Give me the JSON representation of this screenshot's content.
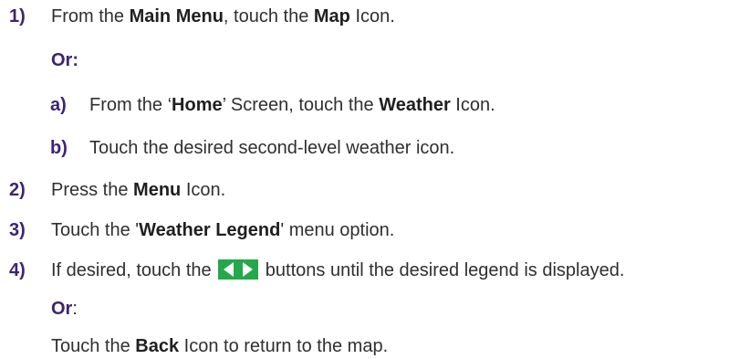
{
  "steps": {
    "s1": {
      "num": "1)",
      "pre": "From the ",
      "b1": "Main Menu",
      "mid": ", touch the ",
      "b2": "Map",
      "post": " Icon."
    },
    "or1": "Or:",
    "sub_a": {
      "num": "a)",
      "pre": "From the ‘",
      "b1": "Home",
      "mid": "’ Screen, touch the ",
      "b2": "Weather",
      "post": " Icon."
    },
    "sub_b": {
      "num": "b)",
      "text": "Touch the desired second-level weather icon."
    },
    "s2": {
      "num": "2)",
      "pre": "Press the ",
      "b1": "Menu",
      "post": " Icon."
    },
    "s3": {
      "num": "3)",
      "pre": "Touch the '",
      "b1": "Weather Legend",
      "post": "' menu option."
    },
    "s4": {
      "num": "4)",
      "pre": "If desired, touch the ",
      "post": " buttons until the desired legend is displayed."
    },
    "or2": {
      "label": "Or",
      "colon": ":"
    },
    "final": {
      "pre": "Touch the ",
      "b1": "Back",
      "post": " Icon to return to the map."
    }
  },
  "icons": {
    "arrows_button": "left-right-arrows-icon"
  },
  "colors": {
    "step_number": "#3d2470",
    "arrow_button_bg": "#24a84a",
    "arrow_button_fg": "#ffffff"
  }
}
